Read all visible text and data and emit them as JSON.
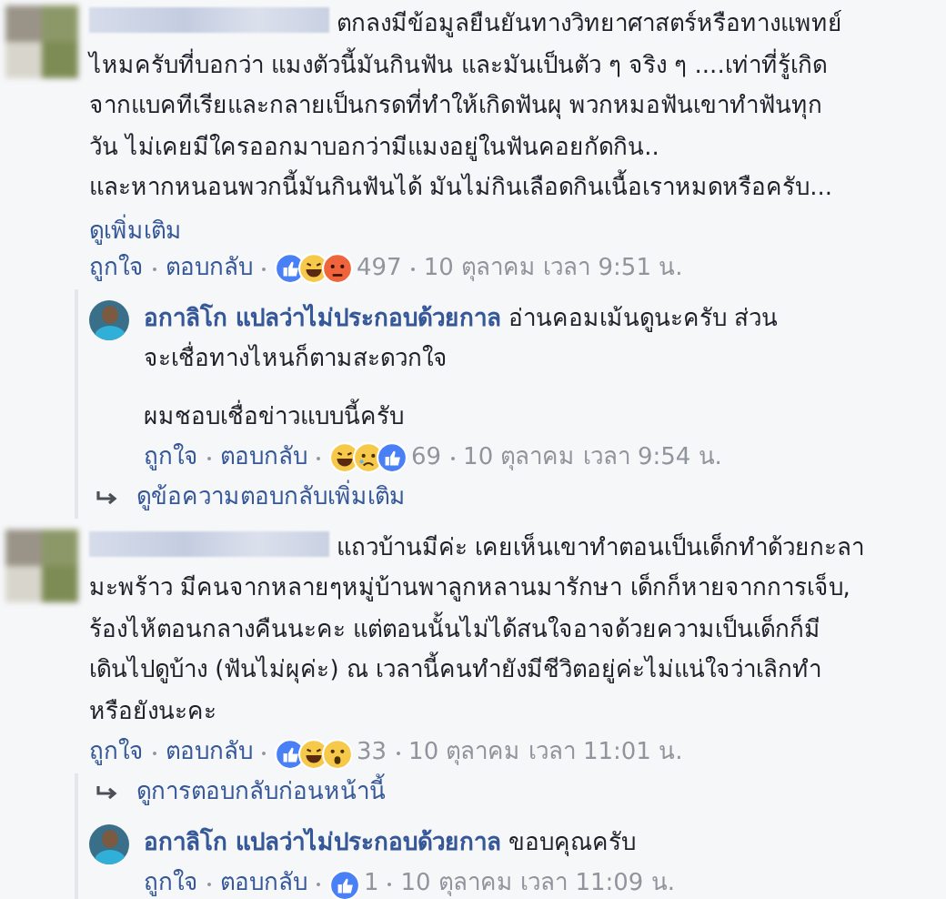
{
  "comments": [
    {
      "text_lines": [
        "ตกลงมีข้อมูลยืนยันทางวิทยาศาสตร์หรือทางแพทย์",
        "ไหมครับที่บอกว่า แมงตัวนี้มันกินฟัน และมันเป็นตัว ๆ จริง ๆ ....เท่าที่รู้เกิด",
        "จากแบคทีเรียและกลายเป็นกรดที่ทำให้เกิดฟันผุ พวกหมอฟันเขาทำฟันทุก",
        "วัน ไม่เคยมีใครออกมาบอกว่ามีแมงอยู่ในฟันคอยกัดกิน..",
        "และหากหนอนพวกนี้มันกินฟันได้ มันไม่กินเลือดกินเนื้อเราหมดหรือครับ..."
      ],
      "see_more": "ดูเพิ่มเติม",
      "like": "ถูกใจ",
      "reply": "ตอบกลับ",
      "reactions": [
        {
          "kind": "like"
        },
        {
          "kind": "haha"
        },
        {
          "kind": "angry"
        }
      ],
      "reaction_count": "497",
      "time": "10 ตุลาคม เวลา 9:51 น.",
      "replies_link": {
        "text": "ดูข้อความตอบกลับเพิ่มเติม",
        "kind": "more"
      },
      "replies": [
        {
          "author": "อกาลิโก แปลว่าไม่ประกอบด้วยกาล",
          "paragraphs": [
            [
              "อ่านคอมเม้นดูนะครับ ส่วน",
              "จะเชื่อทางไหนก็ตามสะดวกใจ"
            ],
            [
              "ผมชอบเชื่อข่าวแบบนี้ครับ"
            ]
          ],
          "like": "ถูกใจ",
          "reply": "ตอบกลับ",
          "reactions": [
            {
              "kind": "haha"
            },
            {
              "kind": "sad"
            },
            {
              "kind": "like"
            }
          ],
          "reaction_count": "69",
          "time": "10 ตุลาคม เวลา 9:54 น."
        }
      ]
    },
    {
      "text_lines": [
        "แถวบ้านมีค่ะ เคยเห็นเขาทำตอนเป็นเด็กทำด้วยกะลา",
        "มะพร้าว มีคนจากหลายๆหมู่บ้านพาลูกหลานมารักษา เด็กก็หายจากการเจ็บ,",
        "ร้องไห้ตอนกลางคืนนะคะ แต่ตอนนั้นไม่ได้สนใจอาจด้วยความเป็นเด็กก็มี",
        "เดินไปดูบ้าง (ฟันไม่ผุค่ะ) ณ เวลานี้คนทำยังมีชีวิตอยู่ค่ะไม่แน่ใจว่าเลิกทำ",
        "หรือยังนะคะ"
      ],
      "like": "ถูกใจ",
      "reply": "ตอบกลับ",
      "reactions": [
        {
          "kind": "like"
        },
        {
          "kind": "haha"
        },
        {
          "kind": "wow"
        }
      ],
      "reaction_count": "33",
      "time": "10 ตุลาคม เวลา 11:01 น.",
      "replies_link": {
        "text": "ดูการตอบกลับก่อนหน้านี้",
        "kind": "previous"
      },
      "replies": [
        {
          "author": "อกาลิโก แปลว่าไม่ประกอบด้วยกาล",
          "paragraphs": [
            [
              "ขอบคุณครับ"
            ]
          ],
          "like": "ถูกใจ",
          "reply": "ตอบกลับ",
          "reactions": [
            {
              "kind": "like"
            }
          ],
          "reaction_count": "1",
          "time": "10 ตุลาคม เวลา 11:09 น."
        }
      ]
    }
  ]
}
